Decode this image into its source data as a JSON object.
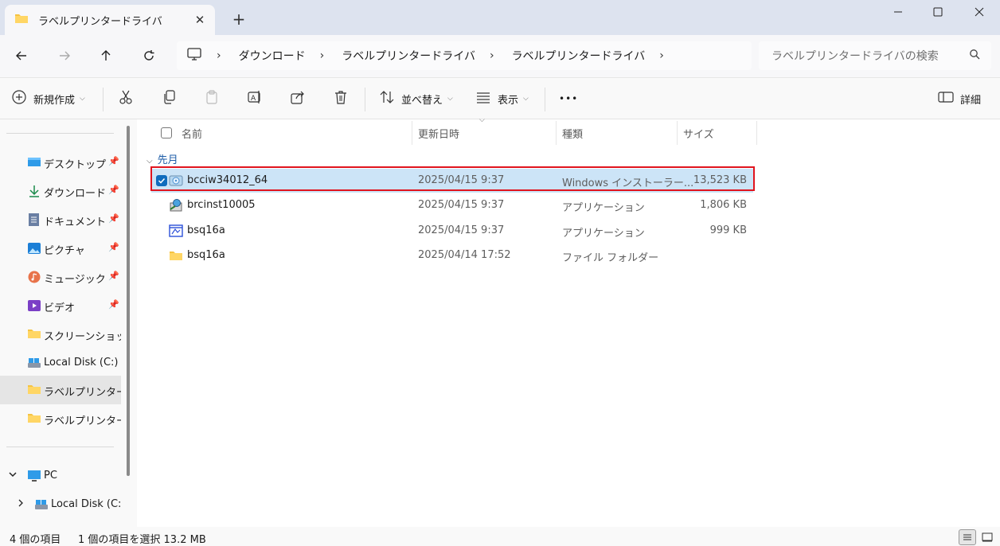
{
  "window": {
    "tab_title": "ラベルプリンタードライバ",
    "tab_close": "✕",
    "new_tab": "+",
    "minimize": "—",
    "maximize": "☐",
    "close": "✕"
  },
  "address": {
    "breadcrumbs": [
      "ダウンロード",
      "ラベルプリンタードライバ",
      "ラベルプリンタードライバ"
    ],
    "separator": "›"
  },
  "search": {
    "placeholder": "ラベルプリンタードライバの検索"
  },
  "commandbar": {
    "new_label": "新規作成",
    "sort_label": "並べ替え",
    "view_label": "表示",
    "more_label": "•••",
    "details_label": "詳細"
  },
  "sidebar": {
    "quick_access": [
      {
        "label": "デスクトップ",
        "icon": "desktop-icon",
        "pinned": true
      },
      {
        "label": "ダウンロード",
        "icon": "download-icon",
        "pinned": true
      },
      {
        "label": "ドキュメント",
        "icon": "documents-icon",
        "pinned": true
      },
      {
        "label": "ピクチャ",
        "icon": "pictures-icon",
        "pinned": true
      },
      {
        "label": "ミュージック",
        "icon": "music-icon",
        "pinned": true
      },
      {
        "label": "ビデオ",
        "icon": "videos-icon",
        "pinned": true
      },
      {
        "label": "スクリーンショット",
        "icon": "folder-icon",
        "pinned": false
      },
      {
        "label": "Local Disk (C:)",
        "icon": "drive-icon",
        "pinned": false
      },
      {
        "label": "ラベルプリンタードラ",
        "icon": "folder-icon",
        "pinned": false,
        "selected": true
      },
      {
        "label": "ラベルプリンタードラ",
        "icon": "folder-icon",
        "pinned": false
      }
    ],
    "pc_label": "PC",
    "pc_child": "Local Disk (C:)"
  },
  "columns": {
    "name": "名前",
    "date": "更新日時",
    "type": "種類",
    "size": "サイズ"
  },
  "group_label": "先月",
  "files": [
    {
      "name": "bcciw34012_64",
      "date": "2025/04/15 9:37",
      "type": "Windows インストーラー...",
      "size": "13,523 KB",
      "icon": "installer-icon",
      "selected": true
    },
    {
      "name": "brcinst10005",
      "date": "2025/04/15 9:37",
      "type": "アプリケーション",
      "size": "1,806 KB",
      "icon": "setup-app-icon",
      "selected": false
    },
    {
      "name": "bsq16a",
      "date": "2025/04/15 9:37",
      "type": "アプリケーション",
      "size": "999 KB",
      "icon": "app-icon",
      "selected": false
    },
    {
      "name": "bsq16a",
      "date": "2025/04/14 17:52",
      "type": "ファイル フォルダー",
      "size": "",
      "icon": "folder-icon",
      "selected": false
    }
  ],
  "status": {
    "item_count": "4 個の項目",
    "selection": "1 個の項目を選択  13.2 MB"
  },
  "colors": {
    "accent": "#0f6cbd",
    "selection": "#cce4f7",
    "highlight": "#e0141e",
    "folder": "#f5c342"
  }
}
